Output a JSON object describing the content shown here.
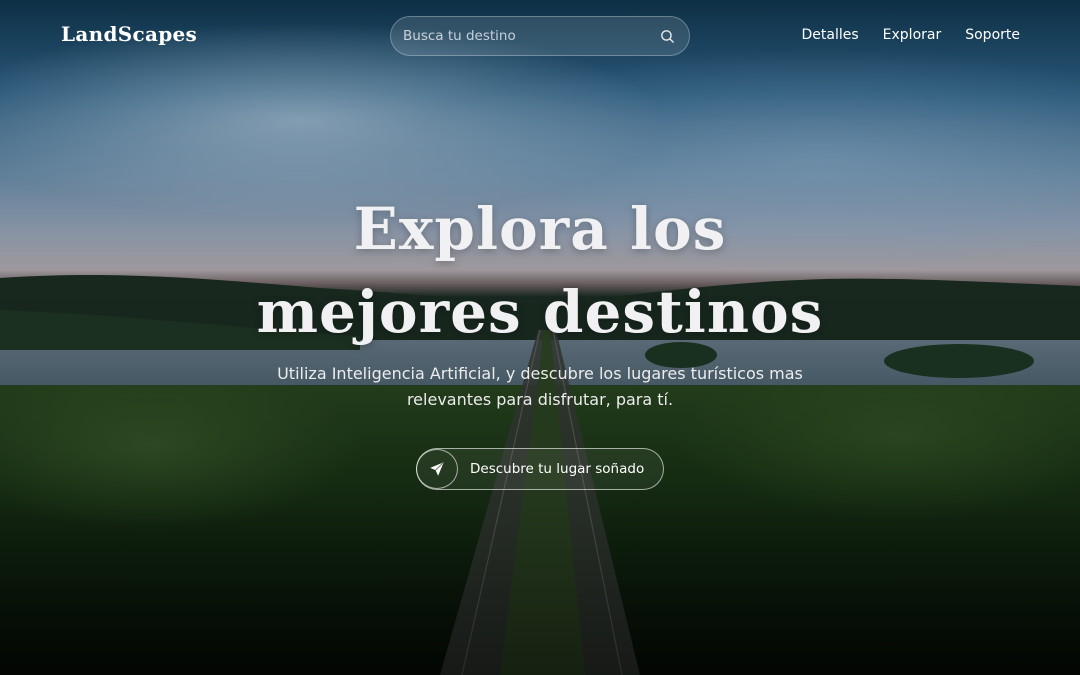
{
  "brand": {
    "logo_text": "LandScapes"
  },
  "search": {
    "placeholder": "Busca tu destino",
    "value": ""
  },
  "nav": {
    "items": [
      {
        "label": "Detalles"
      },
      {
        "label": "Explorar"
      },
      {
        "label": "Soporte"
      }
    ]
  },
  "hero": {
    "title_line1": "Explora los",
    "title_line2": "mejores destinos",
    "subtitle": "Utiliza Inteligencia Artificial, y descubre los lugares turísticos mas relevantes para disfrutar, para tí.",
    "cta_label": "Descubre tu lugar soñado",
    "cta_icon": "paper-plane-icon"
  },
  "colors": {
    "text": "#ffffff",
    "title": "#f1f1f3",
    "sky_top": "#0e3148",
    "forest": "#1d3a18"
  }
}
